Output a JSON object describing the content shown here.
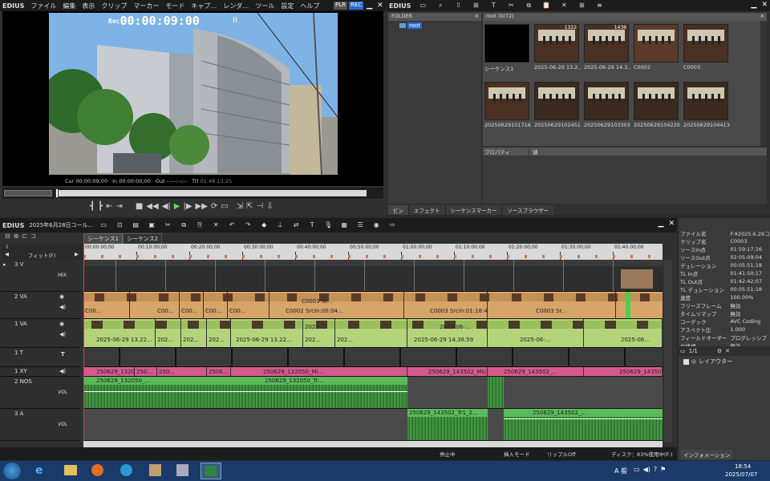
{
  "app": {
    "name": "EDIUS",
    "menu": [
      "ファイル",
      "編集",
      "表示",
      "クリップ",
      "マーカー",
      "モード",
      "キャプ…",
      "レンダ…",
      "ツール",
      "設定",
      "ヘルプ"
    ],
    "plr": "PLR",
    "rec": "REC"
  },
  "player": {
    "rec_tc_label": "Rec",
    "rec_tc": "00:00:09:00",
    "cur_label": "Cur",
    "cur_value": "00:00:09;00",
    "in_label": "In",
    "in_value": "00:00:00;00",
    "out_label": "Out",
    "out_value": "--:--:--;--",
    "ttl_label": "Ttl",
    "ttl_value": "01:48:13;25"
  },
  "bin": {
    "app_name": "EDIUS",
    "folder_header": "FOLDER",
    "root_folder": "root",
    "path_label": "root (0/72)",
    "clips": [
      {
        "name": "シーケンス1",
        "count": ""
      },
      {
        "name": "2025-06-29 13.2...",
        "count": "1322"
      },
      {
        "name": "2025-06-29 14.3...",
        "count": "1438"
      },
      {
        "name": "C0002",
        "count": ""
      },
      {
        "name": "C0003",
        "count": ""
      },
      {
        "name": "20250629101716",
        "count": ""
      },
      {
        "name": "20250629102451",
        "count": ""
      },
      {
        "name": "20250629103303",
        "count": ""
      },
      {
        "name": "20250629104220",
        "count": ""
      },
      {
        "name": "20250629104413",
        "count": ""
      }
    ],
    "property_label": "プロパティ",
    "value_label": "値",
    "tabs": [
      "ビン",
      "エフェクト",
      "シーケンスマーカー",
      "ソースブラウザー"
    ]
  },
  "timeline": {
    "app_name": "EDIUS",
    "project": "2025年6月28日コール...",
    "sequence_tabs": [
      "シーケンス1",
      "シーケンス2"
    ],
    "fit_label": "フィット(F)",
    "ruler_marks": [
      "00:00:00;00",
      "00:10:00;00",
      "00:20:00;00",
      "00:30:00;00",
      "00:40:00;00",
      "00:50:00;00",
      "01:00:00;00",
      "01:10:00;00",
      "01:20:00;00",
      "01:30:00;00",
      "01:40:00;00"
    ],
    "tracks": [
      {
        "id": "3 V",
        "extra": "MIX"
      },
      {
        "id": "2 VA",
        "extra": ""
      },
      {
        "id": "1 VA",
        "extra": ""
      },
      {
        "id": "1 T",
        "extra": "T"
      },
      {
        "id": "1 XY",
        "extra": ""
      },
      {
        "id": "2 NOS",
        "extra": "VOL"
      },
      {
        "id": "3 A",
        "extra": "VOL"
      }
    ],
    "clip_labels": {
      "va2_a": "C0003  Sr...",
      "va2_b": "C0002  SrcIn:00:04...",
      "va2_c": "C0003  SrcIn:01:18:4...",
      "va1_a": "2025-06-29 13.22...",
      "va1_b": "2025-06-29 14.38.59",
      "xy_a": "250629_132050_...",
      "xy_b": "250629_132050_Mi...",
      "xy_c": "250629_143502_Mic...",
      "xy_d": "250629_143502_...",
      "nos_a": "250629_132050_...",
      "nos_b": "250629_132050_Tr...",
      "a3_a": "250629_143502_Tr1_2...",
      "a3_b": "250629_143502_...",
      "short_1": "250...",
      "short_2": "2506...",
      "short_3": "C00...",
      "short_4": "202...",
      "short_5": "2025-...",
      "short_6": "2025-06-...",
      "short_7": "2025-06..."
    }
  },
  "status": {
    "stopped": "停止中",
    "insert_mode": "挿入モード",
    "ripple": "リップルOff",
    "disk": "ディスク：83%使用中(F:)"
  },
  "info": {
    "rows": [
      {
        "k": "ファイル名",
        "v": "F:¥2025.6.29コ..."
      },
      {
        "k": "クリップ名",
        "v": "C0003"
      },
      {
        "k": "ソースIn点",
        "v": "01:59:17;16"
      },
      {
        "k": "ソースOut点",
        "v": "02:05:09;04"
      },
      {
        "k": "デュレーション",
        "v": "00:05:51;18"
      },
      {
        "k": "TL In点",
        "v": "01:41:50;17"
      },
      {
        "k": "TL Out点",
        "v": "01:42:42;07"
      },
      {
        "k": "TL デュレーション",
        "v": "00:05:51;18"
      },
      {
        "k": "速度",
        "v": "100.00%"
      },
      {
        "k": "フリーズフレーム",
        "v": "無効"
      },
      {
        "k": "タイムリマップ",
        "v": "無効"
      },
      {
        "k": "コーデック",
        "v": "AVC Coding"
      },
      {
        "k": "アスペクト比",
        "v": "1.000"
      },
      {
        "k": "フィールドオーダー",
        "v": "プログレッシブ"
      },
      {
        "k": "立体視",
        "v": "無効"
      }
    ],
    "layer_count": "1/1",
    "layer_name": "レイアウター",
    "tab": "インフォメーション"
  },
  "taskbar": {
    "ime": "A 般",
    "time": "18:54",
    "date": "2025/07/07"
  },
  "colors": {
    "accent": "#2a6ad0",
    "video_clip": "#d7a56a",
    "va1_clip": "#b4d47c",
    "xy_clip": "#d45a8a",
    "audio_clip": "#4aa04a",
    "taskbar": "#1a3a6a"
  }
}
